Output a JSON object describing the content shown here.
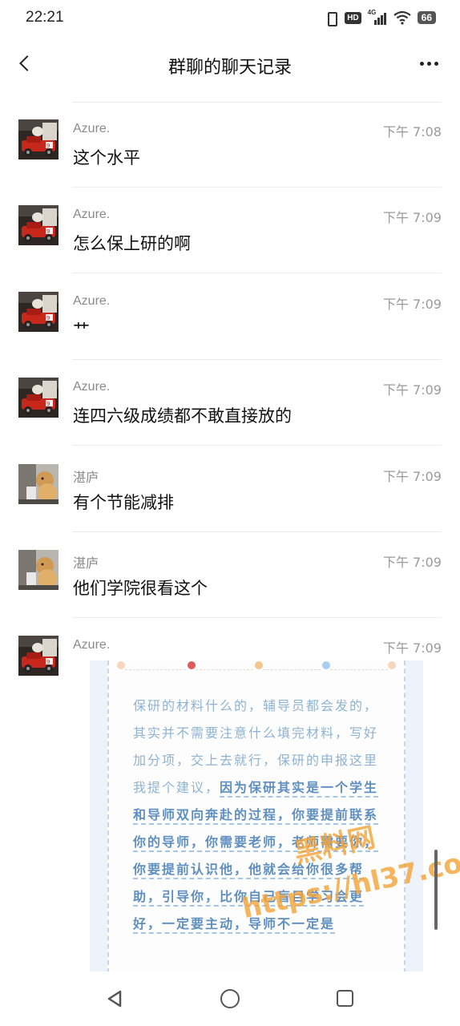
{
  "status_bar": {
    "time": "22:21",
    "hd_badge": "HD",
    "network": "4G",
    "battery": "66"
  },
  "header": {
    "title": "群聊的聊天记录"
  },
  "messages": [
    {
      "sender": "Azure.",
      "time": "下午 7:08",
      "text": "这个水平",
      "avatar_icon": "car-toy-avatar"
    },
    {
      "sender": "Azure.",
      "time": "下午 7:09",
      "text": "怎么保上研的啊",
      "avatar_icon": "car-toy-avatar"
    },
    {
      "sender": "Azure.",
      "time": "下午 7:09",
      "text": "艹",
      "avatar_icon": "car-toy-avatar"
    },
    {
      "sender": "Azure.",
      "time": "下午 7:09",
      "text": "连四六级成绩都不敢直接放的",
      "avatar_icon": "car-toy-avatar"
    },
    {
      "sender": "湛庐",
      "time": "下午 7:09",
      "text": "有个节能减排",
      "avatar_icon": "dog-avatar"
    },
    {
      "sender": "湛庐",
      "time": "下午 7:09",
      "text": "他们学院很看这个",
      "avatar_icon": "dog-avatar"
    }
  ],
  "image_message": {
    "sender": "Azure.",
    "time": "下午 7:09",
    "avatar_icon": "car-toy-avatar",
    "note_plain": "保研的材料什么的，辅导员都会发的，其实并不需要注意什么填完材料，写好加分项，交上去就行，保研的申报这里我提个建议，",
    "note_strong": "因为保研其实是一个学生和导师双向奔赴的过程，你要提前联系你的导师，你需要老师，老师需要你，你要提前认识他，他就会给你很多帮助，引导你，比你自己盲目学习会更好，一定要主动，导师不一定是",
    "watermark_line1": "黑料网",
    "watermark_line2": "https://hl37.co"
  },
  "colors": {
    "accent_note": "#8eb3d2",
    "accent_strong": "#5f8fc0",
    "watermark": "#f3a43a"
  }
}
